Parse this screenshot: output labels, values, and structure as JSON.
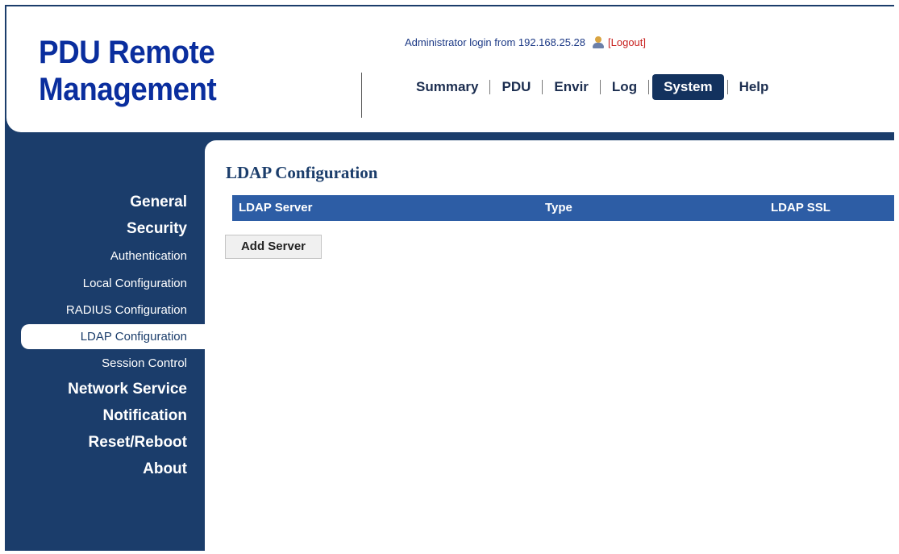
{
  "header": {
    "logo_line1": "PDU Remote",
    "logo_line2": "Management",
    "login_text": "Administrator login from 192.168.25.28",
    "logout_label": "[Logout]"
  },
  "topnav": {
    "items": [
      "Summary",
      "PDU",
      "Envir",
      "Log",
      "System",
      "Help"
    ],
    "active": "System"
  },
  "sidebar": {
    "items": [
      {
        "label": "General",
        "level": "main"
      },
      {
        "label": "Security",
        "level": "main"
      },
      {
        "label": "Authentication",
        "level": "sub"
      },
      {
        "label": "Local Configuration",
        "level": "sub"
      },
      {
        "label": "RADIUS Configuration",
        "level": "sub"
      },
      {
        "label": "LDAP Configuration",
        "level": "sub",
        "active": true
      },
      {
        "label": "Session Control",
        "level": "sub"
      },
      {
        "label": "Network Service",
        "level": "main"
      },
      {
        "label": "Notification",
        "level": "main"
      },
      {
        "label": "Reset/Reboot",
        "level": "main"
      },
      {
        "label": "About",
        "level": "main"
      }
    ]
  },
  "main": {
    "title": "LDAP Configuration",
    "table_columns": [
      "LDAP Server",
      "Type",
      "LDAP SSL"
    ],
    "add_button_label": "Add Server"
  },
  "colors": {
    "brand_blue": "#1b3d6b",
    "logo_blue": "#0a2e9e",
    "table_header": "#2d5da5",
    "logout_red": "#c8201e"
  }
}
